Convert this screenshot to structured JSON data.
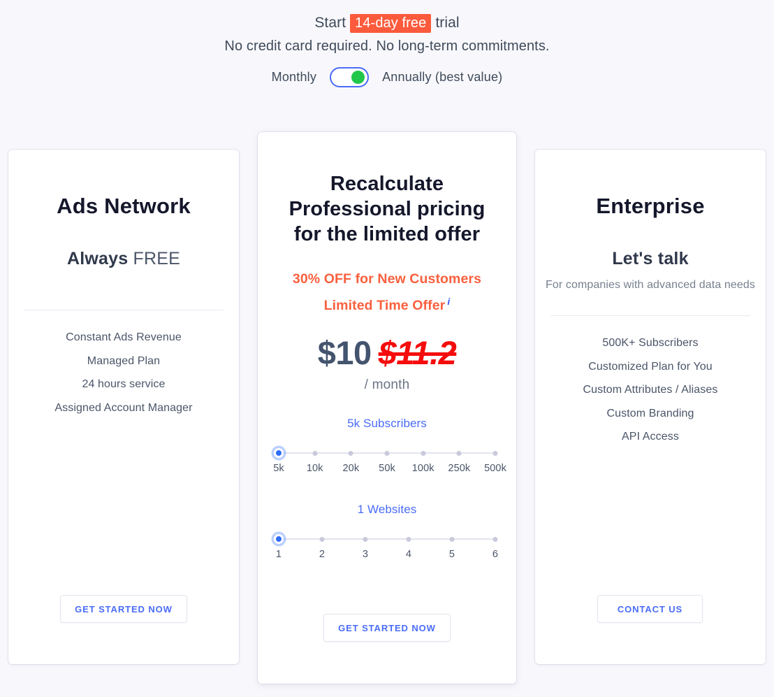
{
  "header": {
    "trial_prefix": "Start",
    "trial_badge": "14-day free",
    "trial_suffix": "trial",
    "subline": "No credit card required. No long-term commitments."
  },
  "billing": {
    "monthly_label": "Monthly",
    "annually_label": "Annually (best value)",
    "selected": "Annually (best value)",
    "toggle_on_color": "#21c74a",
    "toggle_border_color": "#4a6cf7"
  },
  "plans": {
    "left": {
      "title": "Ads Network",
      "price_strong": "Always",
      "price_rest": "FREE",
      "features": [
        "Constant Ads Revenue",
        "Managed Plan",
        "24 hours service",
        "Assigned Account Manager"
      ],
      "cta": "GET STARTED NOW"
    },
    "center": {
      "title_line1": "Recalculate",
      "title_line2": "Professional pricing",
      "title_line3": "for the limited offer",
      "offer_line1": "30% OFF for New Customers",
      "offer_line2": "Limited Time Offer",
      "info_icon": "i",
      "price_new": "$10",
      "price_old": "$11.2",
      "per_period": "/ month",
      "subscribers_value": "5k Subscribers",
      "subscribers_ticks": [
        "5k",
        "10k",
        "20k",
        "50k",
        "100k",
        "250k",
        "500k"
      ],
      "subscribers_selected_index": 0,
      "websites_value": "1 Websites",
      "websites_ticks": [
        "1",
        "2",
        "3",
        "4",
        "5",
        "6"
      ],
      "websites_selected_index": 0,
      "cta": "GET STARTED NOW"
    },
    "right": {
      "title": "Enterprise",
      "price_strong": "Let's talk",
      "subtitle": "For companies with advanced data needs",
      "features": [
        "500K+ Subscribers",
        "Customized Plan for You",
        "Custom Attributes / Aliases",
        "Custom Branding",
        "API Access"
      ],
      "cta": "CONTACT US"
    }
  },
  "colors": {
    "page_background": "#f8f8fc",
    "badge": "#fc5a3c",
    "accent_blue": "#4a6cf7",
    "offer_orange": "#f9603e",
    "old_price_red": "#f50c0c",
    "price_slate": "#44546e"
  }
}
